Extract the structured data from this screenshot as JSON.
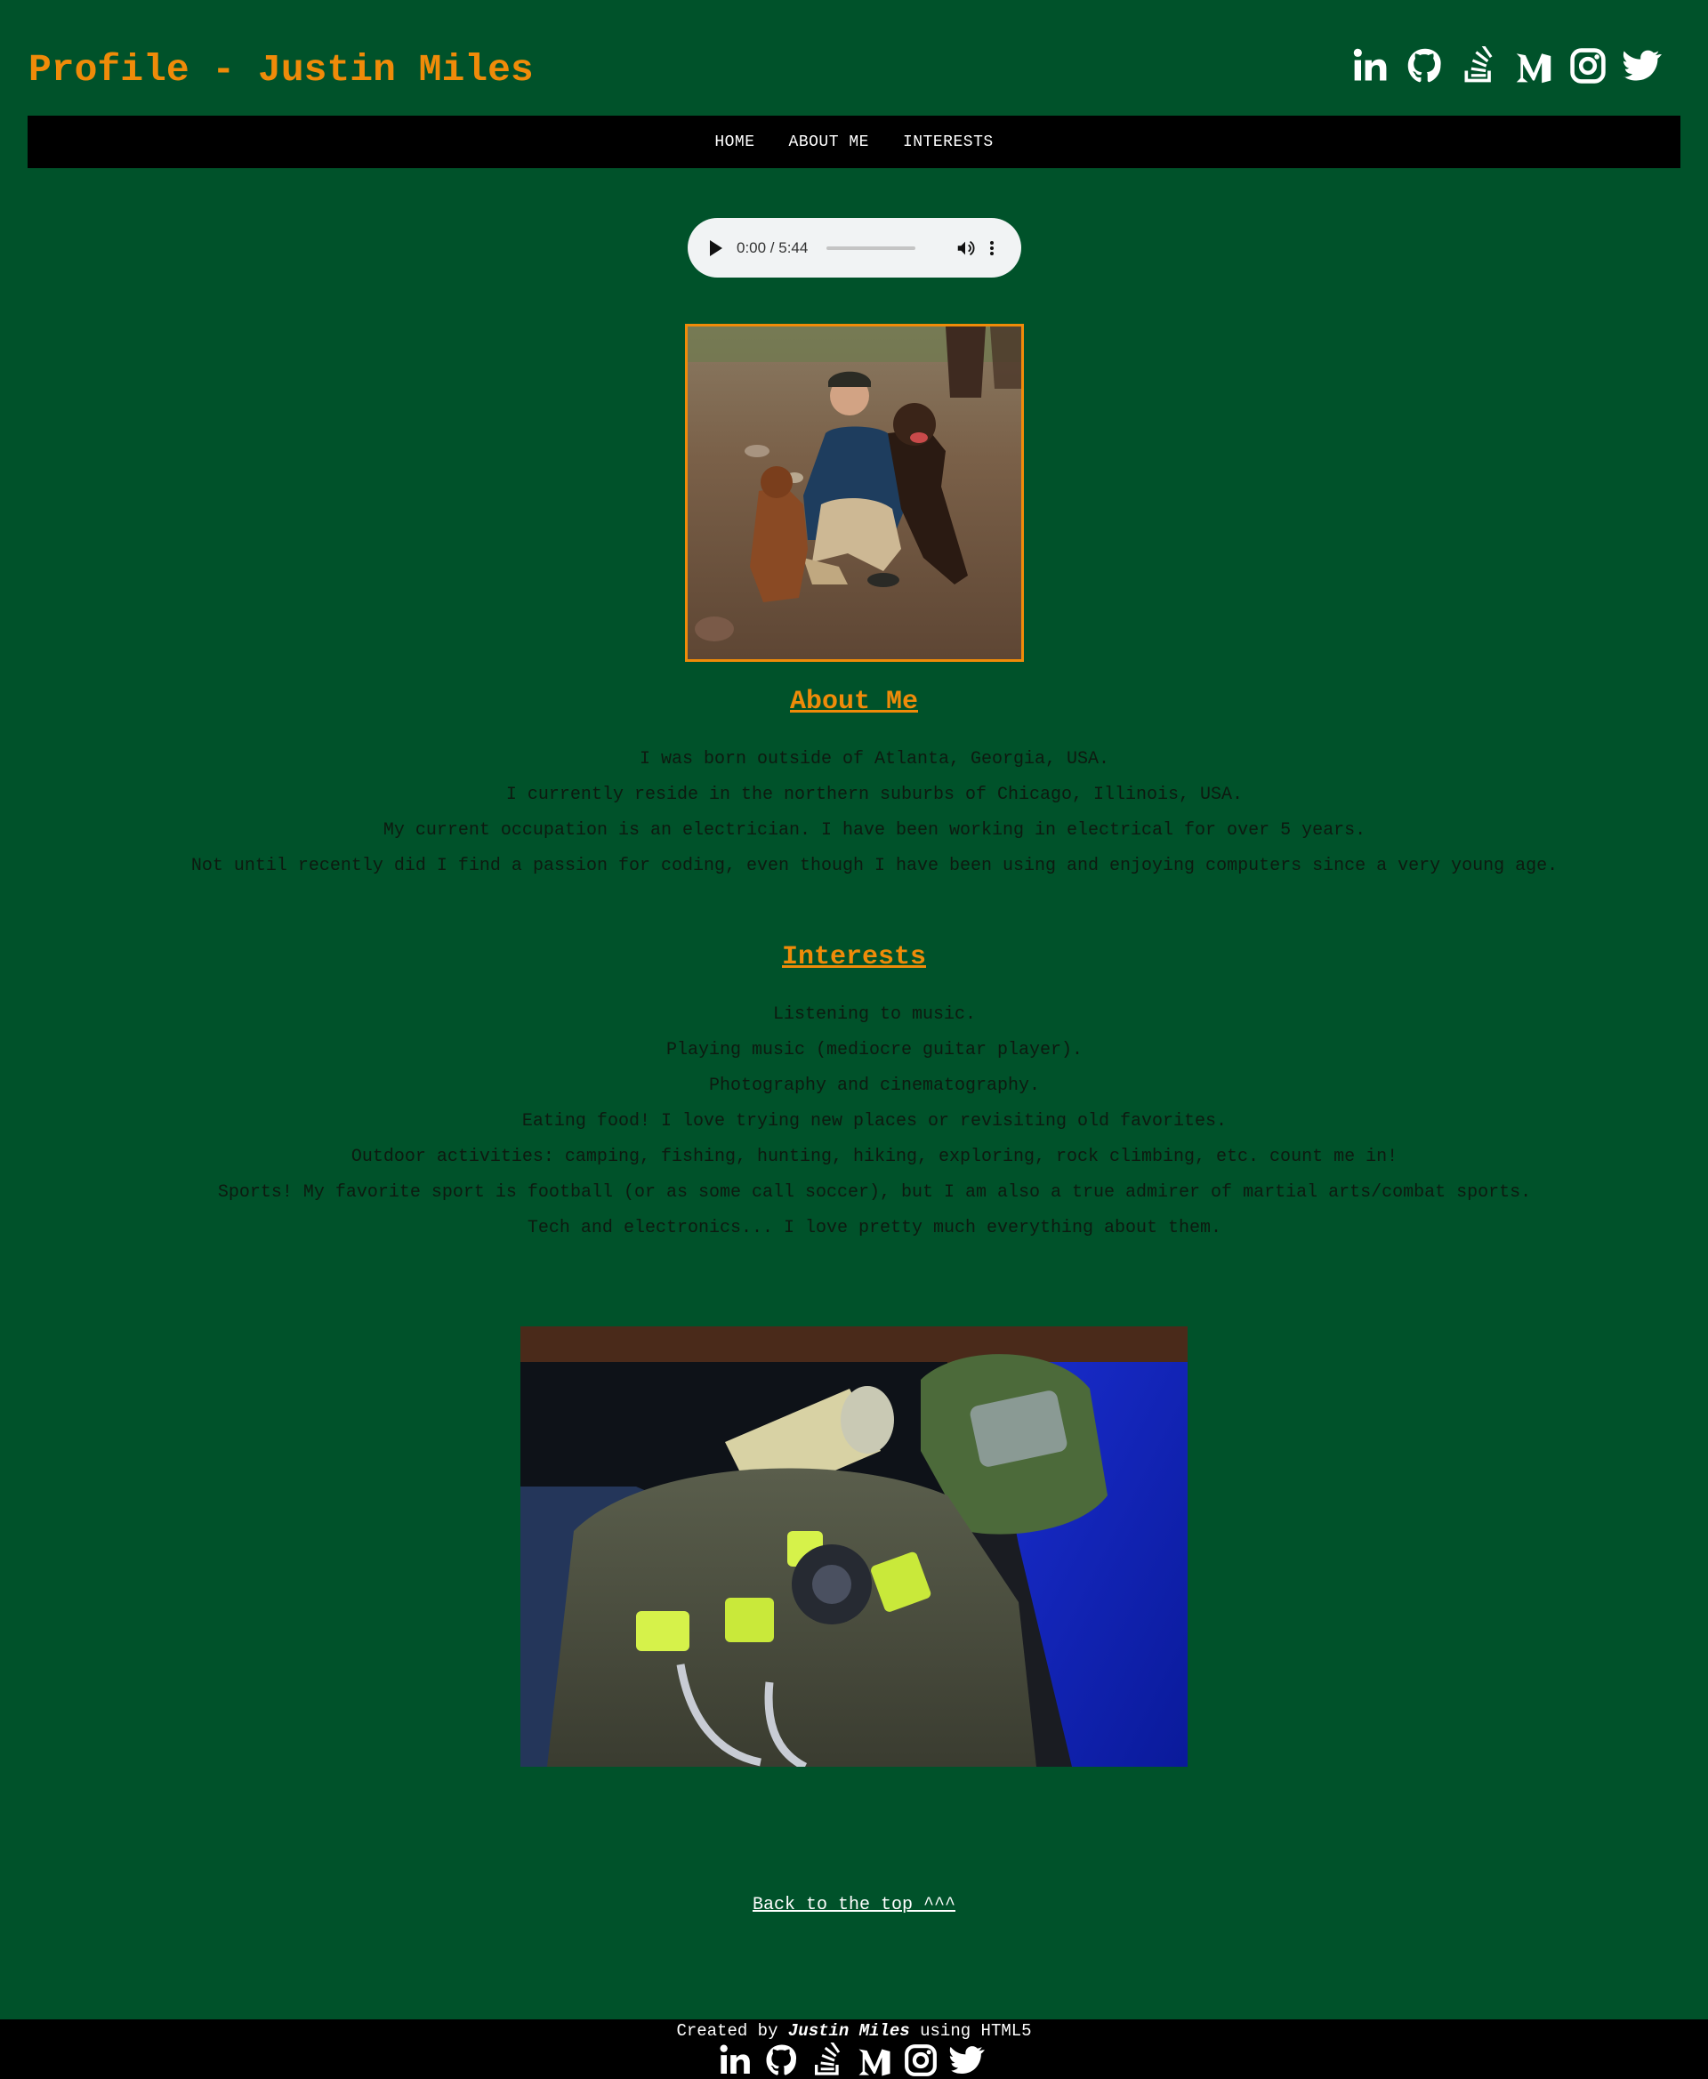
{
  "header": {
    "title": "Profile - Justin Miles",
    "social_icons": [
      "linkedin-icon",
      "github-icon",
      "stack-overflow-icon",
      "medium-icon",
      "instagram-icon",
      "twitter-icon"
    ]
  },
  "nav": {
    "items": [
      {
        "label": "HOME"
      },
      {
        "label": "ABOUT ME"
      },
      {
        "label": "INTERESTS"
      }
    ]
  },
  "audio": {
    "time": "0:00 / 5:44",
    "progress": 0
  },
  "profile_image": {
    "description_icon": "photo-man-with-two-dogs"
  },
  "about": {
    "heading": "About Me",
    "lines": [
      "I was born outside of Atlanta, Georgia, USA.",
      "I currently reside in the northern suburbs of Chicago, Illinois, USA.",
      "My current occupation is an electrician. I have been working in electrical for over 5 years.",
      "Not until recently did I find a passion for coding, even though I have been using and enjoying computers since a very young age."
    ]
  },
  "interests": {
    "heading": "Interests",
    "lines": [
      "Listening to music.",
      "Playing music (mediocre guitar player).",
      "Photography and cinematography.",
      "Eating food! I love trying new places or revisiting old favorites.",
      "Outdoor activities: camping, fishing, hunting, hiking, exploring, rock climbing, etc. count me in!",
      "Sports! My favorite sport is football (or as some call soccer), but I am also a true admirer of martial arts/combat sports.",
      "Tech and electronics... I love pretty much everything about them."
    ]
  },
  "gear_image": {
    "description_icon": "photo-camping-gear-with-beer-can"
  },
  "back_to_top": "Back to the top ^^^",
  "footer": {
    "credit_prefix": "Created by",
    "credit_name": "Justin Miles",
    "credit_suffix": "using HTML5"
  },
  "colors": {
    "background": "#00522a",
    "accent": "#ef8b09",
    "nav": "#000000",
    "text": "#0d1a10"
  }
}
